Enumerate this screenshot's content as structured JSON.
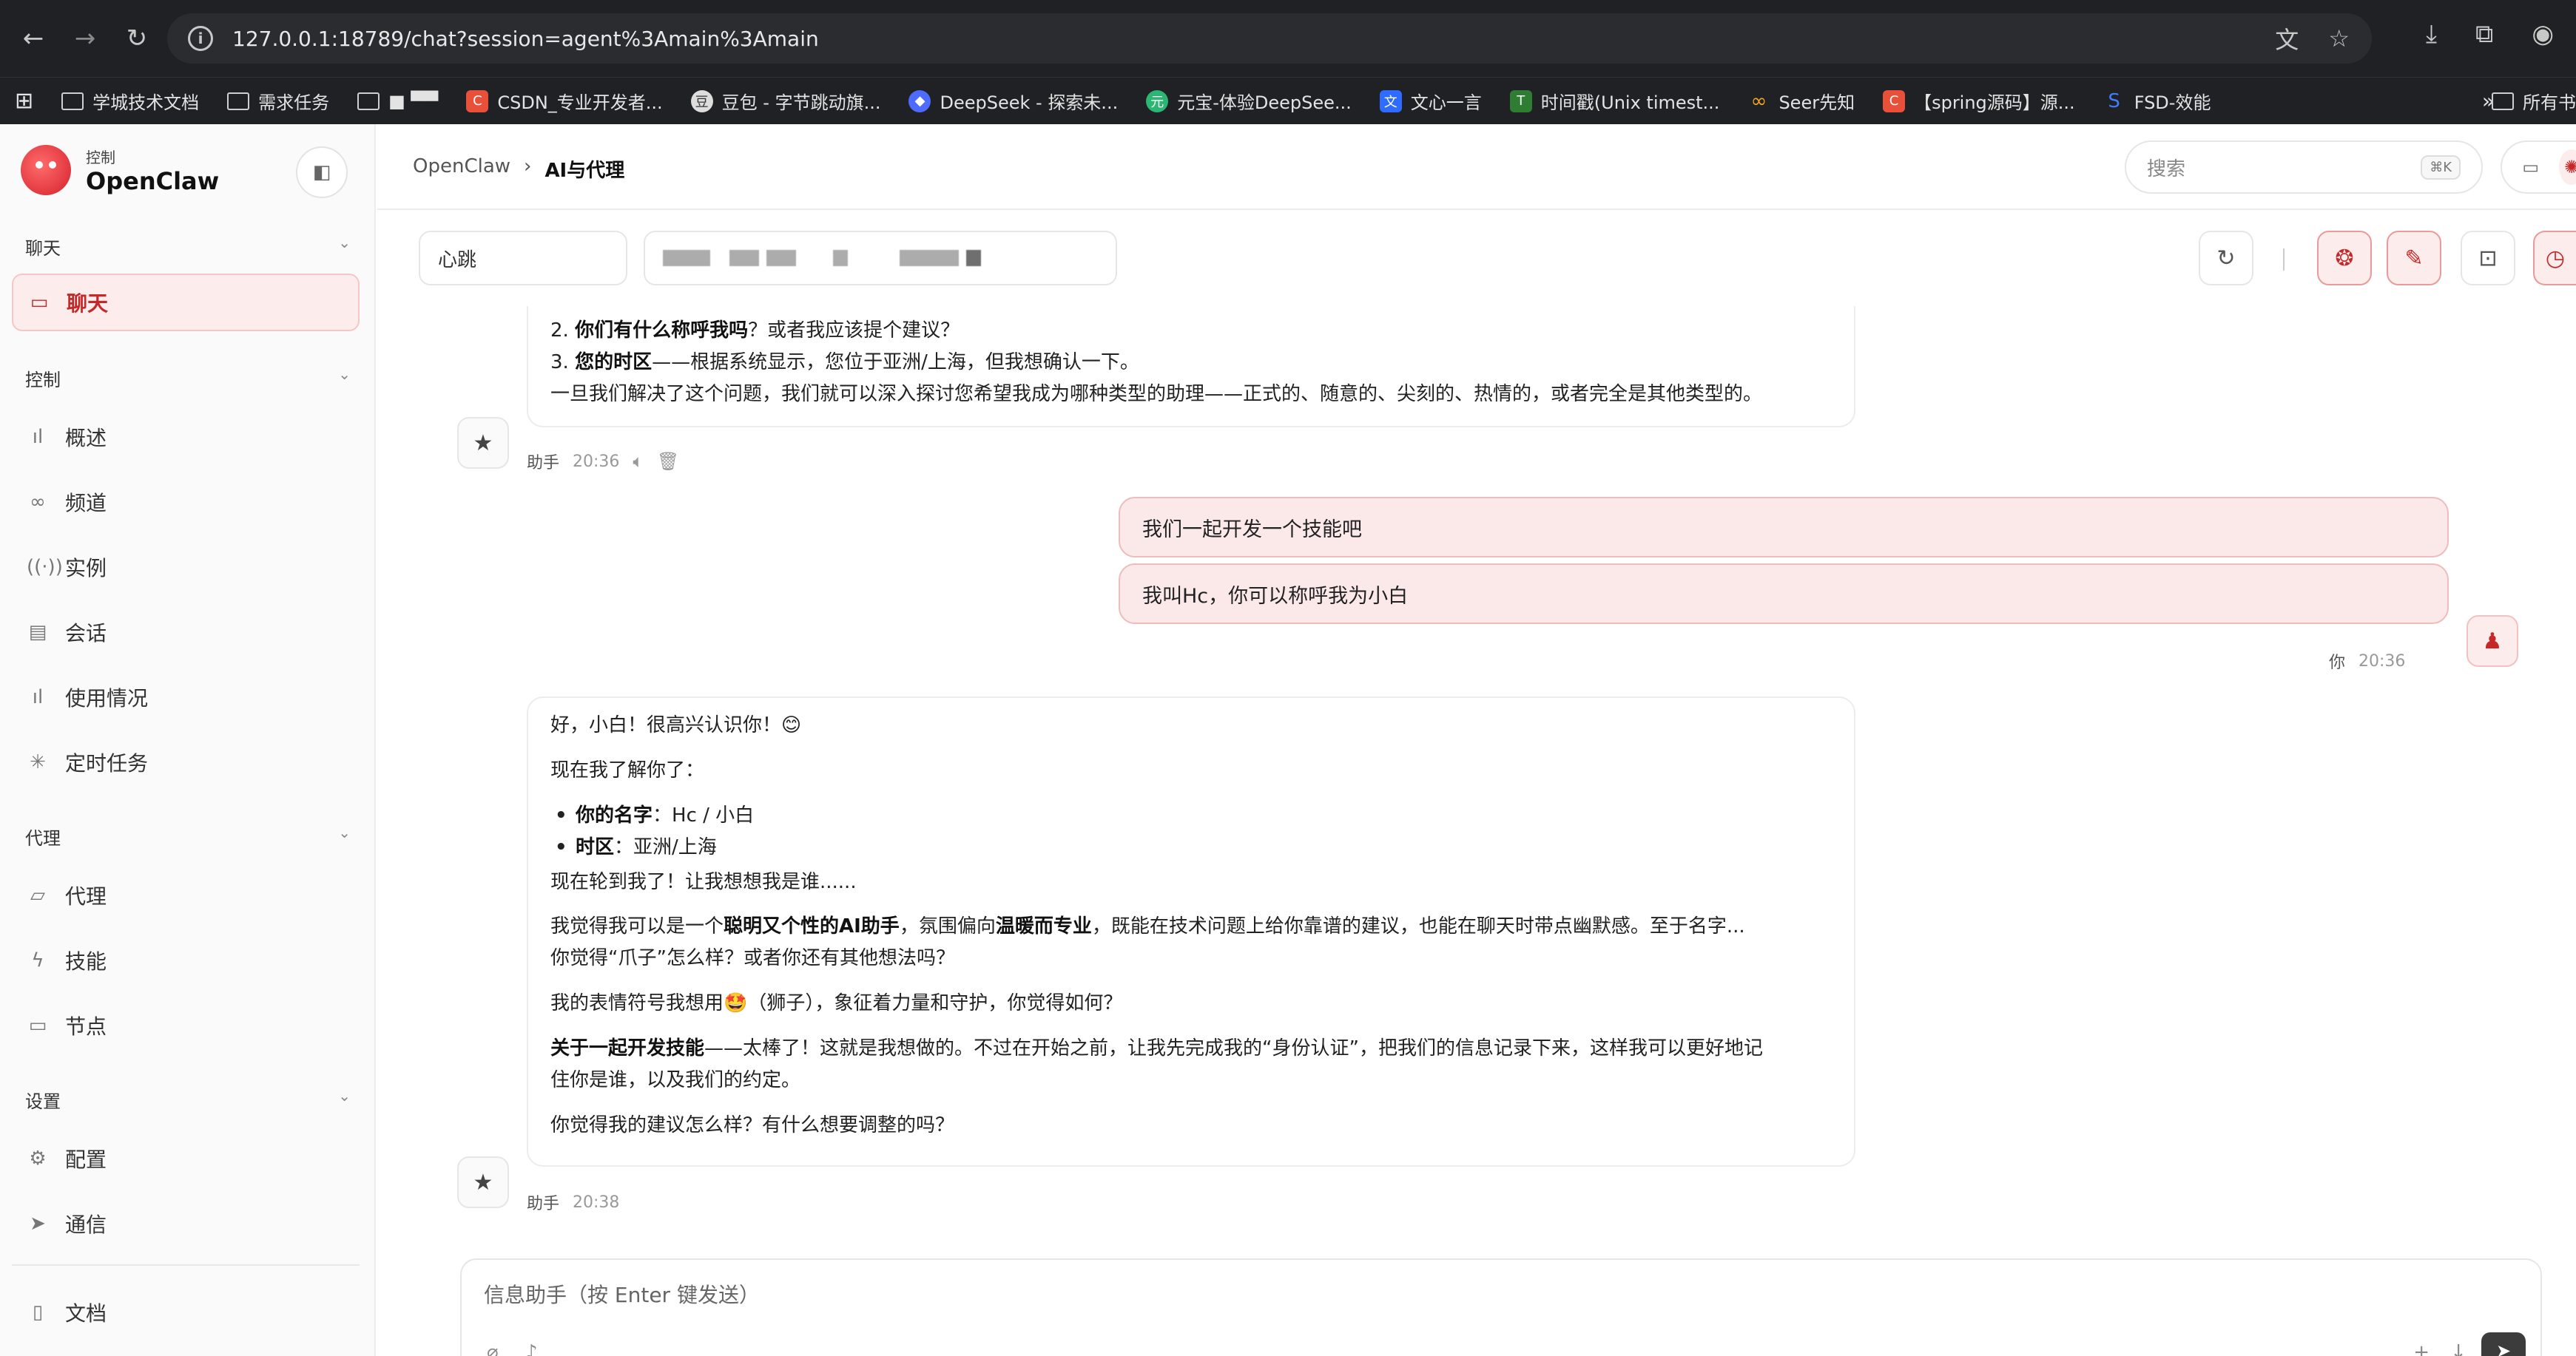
{
  "browser": {
    "url": "127.0.0.1:18789/chat?session=agent%3Amain%3Amain",
    "bookmarks": [
      {
        "label": "学城技术文档",
        "icon": "folder-icon"
      },
      {
        "label": "需求任务",
        "icon": "folder-icon"
      },
      {
        "label": "■ ▀▀",
        "icon": "folder-icon"
      },
      {
        "label": "CSDN_专业开发者...",
        "icon": "csdn-icon",
        "color": "#e8503a"
      },
      {
        "label": "豆包 - 字节跳动旗...",
        "icon": "doubao-icon"
      },
      {
        "label": "DeepSeek - 探索未...",
        "icon": "deepseek-icon",
        "color": "#4d6bfe"
      },
      {
        "label": "元宝-体验DeepSee...",
        "icon": "yuanbao-icon",
        "color": "#2bb673"
      },
      {
        "label": "文心一言",
        "icon": "wenxin-icon",
        "color": "#2f6bff"
      },
      {
        "label": "时间戳(Unix timest...",
        "icon": "timestamp-icon",
        "color": "#2e7d32"
      },
      {
        "label": "Seer先知",
        "icon": "seer-icon",
        "color": "#f5a623"
      },
      {
        "label": "【spring源码】源...",
        "icon": "csdn-icon",
        "color": "#e8503a"
      },
      {
        "label": "FSD-效能",
        "icon": "fsd-icon",
        "color": "#3f7cff"
      }
    ],
    "more": "»",
    "last_folder": "所有书"
  },
  "sidebar": {
    "brand_sub": "控制",
    "brand_title": "OpenClaw",
    "sections": {
      "chat": "聊天",
      "control": "控制",
      "agent": "代理",
      "settings": "设置"
    },
    "items": {
      "chat": "聊天",
      "overview": "概述",
      "channels": "频道",
      "instances": "实例",
      "sessions": "会话",
      "usage": "使用情况",
      "cron": "定时任务",
      "agents": "代理",
      "skills": "技能",
      "nodes": "节点",
      "config": "配置",
      "comms": "通信",
      "docs": "文档"
    }
  },
  "header": {
    "crumb_root": "OpenClaw",
    "crumb_sep": "›",
    "crumb_current": "AI与代理",
    "search_placeholder": "搜索",
    "search_kbd": "⌘K"
  },
  "toolbar": {
    "session_select": "心跳"
  },
  "messages": {
    "assistant_1": {
      "line_2_bold": "你们有什么称呼我吗",
      "line_2_rest": "？或者我应该提个建议？",
      "line_3_bold": "您的时区",
      "line_3_rest": "——根据系统显示，您位于亚洲/上海，但我想确认一下。",
      "line_4": "一旦我们解决了这个问题，我们就可以深入探讨您希望我成为哪种类型的助理——正式的、随意的、尖刻的、热情的，或者完全是其他类型的。",
      "num_2": "2.",
      "num_3": "3.",
      "sender": "助手",
      "time": "20:36"
    },
    "user_1": {
      "text_1": "我们一起开发一个技能吧",
      "text_2": "我叫Hc，你可以称呼我为小白",
      "sender": "你",
      "time": "20:36"
    },
    "assistant_2": {
      "p1": "好，小白！很高兴认识你！😊",
      "p2": "现在我了解你了：",
      "li1_bold": "你的名字",
      "li1_rest": "：Hc / 小白",
      "li2_bold": "时区",
      "li2_rest": "：亚洲/上海",
      "p3": "现在轮到我了！让我想想我是谁......",
      "p4_a": "我觉得我可以是一个",
      "p4_b": "聪明又个性的AI助手",
      "p4_c": "，氛围偏向",
      "p4_d": "温暖而专业",
      "p4_e": "，既能在技术问题上给你靠谱的建议，也能在聊天时带点幽默感。至于名字...",
      "p4_f": "你觉得“爪子”怎么样？或者你还有其他想法吗？",
      "p5": "我的表情符号我想用🤩（狮子），象征着力量和守护，你觉得如何？",
      "p6_bold": "关于一起开发技能",
      "p6_rest": "——太棒了！这就是我想做的。不过在开始之前，让我先完成我的“身份认证”，把我们的信息记录下来，这样我可以更好地记",
      "p6_cont": "住你是谁，以及我们的约定。",
      "p7": "你觉得我的建议怎么样？有什么想要调整的吗？",
      "sender": "助手",
      "time": "20:38"
    }
  },
  "composer": {
    "placeholder": "信息助手（按 Enter 键发送）"
  },
  "colors": {
    "accent": "#c62828",
    "accent_bg": "#fdecec",
    "user_bubble": "#fbe9e9"
  }
}
